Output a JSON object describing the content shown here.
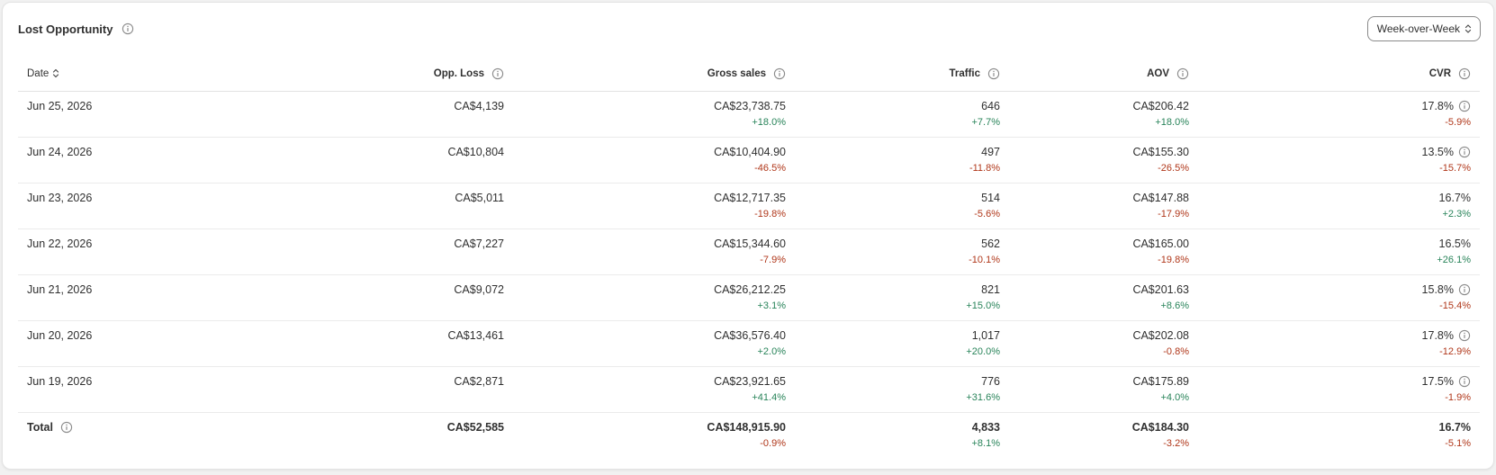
{
  "card": {
    "title": "Lost Opportunity",
    "period_select": "Week-over-Week"
  },
  "columns": {
    "date": "Date",
    "opp_loss": "Opp. Loss",
    "gross_sales": "Gross sales",
    "traffic": "Traffic",
    "aov": "AOV",
    "cvr": "CVR"
  },
  "rows": [
    {
      "date": "Jun 25, 2026",
      "opp_loss": "CA$4,139",
      "gross": "CA$23,738.75",
      "gross_delta": "+18.0%",
      "traffic": "646",
      "traffic_delta": "+7.7%",
      "aov": "CA$206.42",
      "aov_delta": "+18.0%",
      "cvr": "17.8%",
      "cvr_delta": "-5.9%",
      "cvr_info": true
    },
    {
      "date": "Jun 24, 2026",
      "opp_loss": "CA$10,804",
      "gross": "CA$10,404.90",
      "gross_delta": "-46.5%",
      "traffic": "497",
      "traffic_delta": "-11.8%",
      "aov": "CA$155.30",
      "aov_delta": "-26.5%",
      "cvr": "13.5%",
      "cvr_delta": "-15.7%",
      "cvr_info": true
    },
    {
      "date": "Jun 23, 2026",
      "opp_loss": "CA$5,011",
      "gross": "CA$12,717.35",
      "gross_delta": "-19.8%",
      "traffic": "514",
      "traffic_delta": "-5.6%",
      "aov": "CA$147.88",
      "aov_delta": "-17.9%",
      "cvr": "16.7%",
      "cvr_delta": "+2.3%",
      "cvr_info": false
    },
    {
      "date": "Jun 22, 2026",
      "opp_loss": "CA$7,227",
      "gross": "CA$15,344.60",
      "gross_delta": "-7.9%",
      "traffic": "562",
      "traffic_delta": "-10.1%",
      "aov": "CA$165.00",
      "aov_delta": "-19.8%",
      "cvr": "16.5%",
      "cvr_delta": "+26.1%",
      "cvr_info": false
    },
    {
      "date": "Jun 21, 2026",
      "opp_loss": "CA$9,072",
      "gross": "CA$26,212.25",
      "gross_delta": "+3.1%",
      "traffic": "821",
      "traffic_delta": "+15.0%",
      "aov": "CA$201.63",
      "aov_delta": "+8.6%",
      "cvr": "15.8%",
      "cvr_delta": "-15.4%",
      "cvr_info": true
    },
    {
      "date": "Jun 20, 2026",
      "opp_loss": "CA$13,461",
      "gross": "CA$36,576.40",
      "gross_delta": "+2.0%",
      "traffic": "1,017",
      "traffic_delta": "+20.0%",
      "aov": "CA$202.08",
      "aov_delta": "-0.8%",
      "cvr": "17.8%",
      "cvr_delta": "-12.9%",
      "cvr_info": true
    },
    {
      "date": "Jun 19, 2026",
      "opp_loss": "CA$2,871",
      "gross": "CA$23,921.65",
      "gross_delta": "+41.4%",
      "traffic": "776",
      "traffic_delta": "+31.6%",
      "aov": "CA$175.89",
      "aov_delta": "+4.0%",
      "cvr": "17.5%",
      "cvr_delta": "-1.9%",
      "cvr_info": true
    }
  ],
  "total": {
    "label": "Total",
    "opp_loss": "CA$52,585",
    "gross": "CA$148,915.90",
    "gross_delta": "-0.9%",
    "traffic": "4,833",
    "traffic_delta": "+8.1%",
    "aov": "CA$184.30",
    "aov_delta": "-3.2%",
    "cvr": "16.7%",
    "cvr_delta": "-5.1%"
  },
  "colors": {
    "positive": "#29845a",
    "negative": "#b0371a",
    "text": "#303030",
    "icon": "#8a8a8a"
  },
  "icons": {
    "info": "info-circle-icon",
    "sort": "sort-arrows-icon",
    "select": "chevron-up-down-icon"
  }
}
